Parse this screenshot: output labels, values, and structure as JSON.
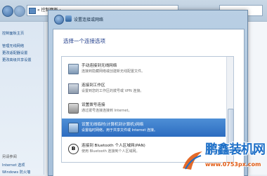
{
  "background_window": {
    "address": "« 控制面板 ›",
    "sidebar": {
      "home": "控制面板主页",
      "items": [
        "管理无线网络",
        "更改适配器设置",
        "更改高级共享设置"
      ],
      "see_also_heading": "另请参阅",
      "see_also": [
        "Internet 选项",
        "Windows 防火墙"
      ]
    }
  },
  "dialog": {
    "title": "设置连接或网络",
    "heading": "选择一个连接选项",
    "options": [
      {
        "title": "手动连接到无线网络",
        "desc": "连接到隐藏网络或创建新无线配置文件。",
        "icon": "wireless-network-icon"
      },
      {
        "title": "连接到工作区",
        "desc": "设置到您的工作区的拨号或 VPN 连接。",
        "icon": "workplace-icon"
      },
      {
        "title": "设置拨号连接",
        "desc": "通过拨号连接连接到 Internet。",
        "icon": "dialup-modem-icon"
      },
      {
        "title": "设置无线临时(计算机到计算机)网络",
        "desc": "设置临时网络，用于共享文件或 Internet 连接。",
        "icon": "adhoc-network-icon",
        "selected": true
      },
      {
        "title": "连接到 Bluetooth 个人区域网(PAN)",
        "desc": "使用 Bluetooth 连接到个人区域网。",
        "icon": "bluetooth-icon"
      }
    ]
  },
  "watermark": {
    "brand": "鹏鑫装机网",
    "url": "www.0753px.com"
  },
  "colors": {
    "selection": "#2c6cc0",
    "heading": "#1e3b8a",
    "link": "#1b4f8a",
    "watermark_brand": "#1d6fc7",
    "watermark_url": "#e15a12"
  }
}
